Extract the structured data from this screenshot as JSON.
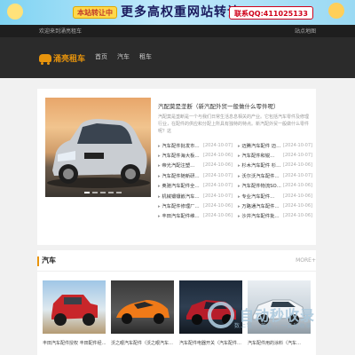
{
  "banner": {
    "badge": "本站转让中",
    "headline": "更多高权重网站转让",
    "contact": "联系QQ:411025133"
  },
  "topbar": {
    "welcome": "欢迎来到涌亮租车",
    "sitemap": "站点地图"
  },
  "logo": {
    "text": "涌亮租车"
  },
  "nav": {
    "items": [
      "首页",
      "汽车",
      "租车"
    ]
  },
  "featured": {
    "title": "汽配莫是垄断（新汽配外贸一般做什么零件呢）",
    "desc": "汽配莫是垄断是一个与我们日常生活息息相关的产业。它包括汽车零件及修理行业，在配件的供应和分配上所具有独特的特点。新汽配外贸一般做什么零件呢？这"
  },
  "list_left": [
    {
      "t": "汽车配件批发市…",
      "d": "[2024-10-07]"
    },
    {
      "t": "汽车配件海大板…",
      "d": "[2024-10-06]"
    },
    {
      "t": "帝光汽配注塑…",
      "d": "[2024-10-06]"
    },
    {
      "t": "汽车配件随新研…",
      "d": "[2024-10-07]"
    },
    {
      "t": "奥驰汽车配件全…",
      "d": "[2024-10-07]"
    },
    {
      "t": "机械镶镶嵌汽车…",
      "d": "[2024-10-07]"
    },
    {
      "t": "汽车配件修理厂…",
      "d": "[2024-10-06]"
    },
    {
      "t": "丰田汽车配件维…",
      "d": "[2024-10-06]"
    }
  ],
  "list_right": [
    {
      "t": "迈腾汽车配件 迈…",
      "d": "[2024-10-07]"
    },
    {
      "t": "汽车配件和锐…",
      "d": "[2024-10-07]"
    },
    {
      "t": "杉木汽车配件 杉…",
      "d": "[2024-10-06]"
    },
    {
      "t": "沃尔沃汽车配件…",
      "d": "[2024-10-07]"
    },
    {
      "t": "汽车配件物流SO…",
      "d": "[2024-10-06]"
    },
    {
      "t": "专业汽车配件…",
      "d": "[2024-10-06]"
    },
    {
      "t": "万路通汽车配件…",
      "d": "[2024-10-06]"
    },
    {
      "t": "沙井汽车配件批…",
      "d": "[2024-10-06]"
    }
  ],
  "section": {
    "title": "汽车",
    "more": "MORE+",
    "items": [
      {
        "caption": "丰田汽车配件授权 丰田配件经…"
      },
      {
        "caption": "沃之眼汽车配件（沃之眼汽车…"
      },
      {
        "caption": "汽车配件电器开关（汽车配件…"
      },
      {
        "caption": "汽车配件用的涂料（汽车…"
      }
    ]
  },
  "watermark": {
    "big": "自动秒收录",
    "small": "数上链 . 莱秒 . 一云秒收录"
  },
  "colors": {
    "accent": "#e8940c",
    "nav_bg": "#2b2b2b",
    "topbar_bg": "#1e1e1e"
  }
}
